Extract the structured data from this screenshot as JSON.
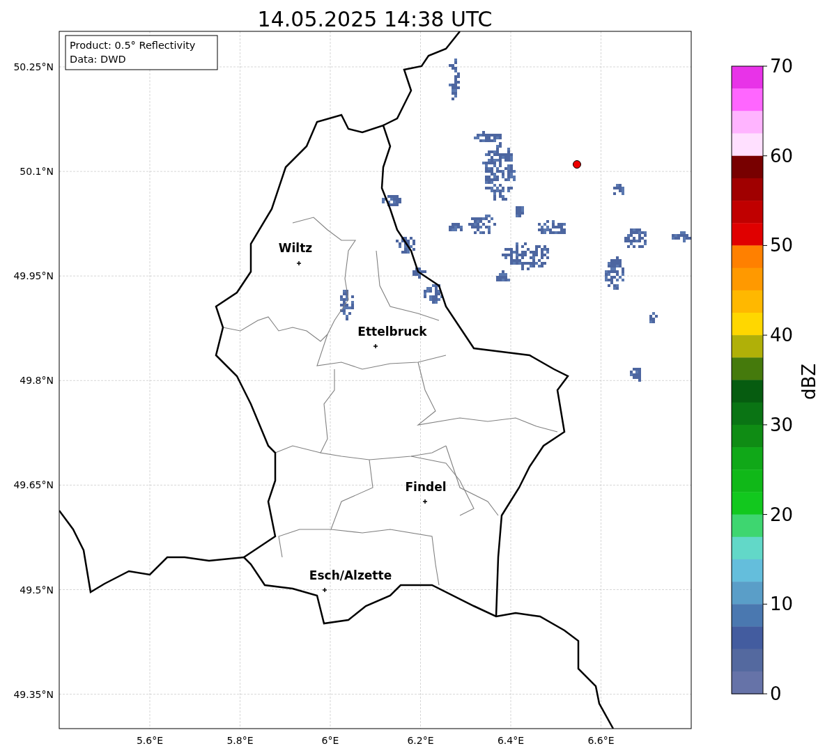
{
  "title": "14.05.2025 14:38 UTC",
  "info_box": [
    "Product: 0.5° Reflectivity",
    "Data: DWD"
  ],
  "lat_ticks": [
    "50.25°N",
    "50.1°N",
    "49.95°N",
    "49.8°N",
    "49.65°N",
    "49.5°N",
    "49.35°N"
  ],
  "lon_ticks": [
    "5.6°E",
    "5.8°E",
    "6°E",
    "6.2°E",
    "6.4°E",
    "6.6°E"
  ],
  "cities": [
    {
      "name": "Wiltz"
    },
    {
      "name": "Ettelbruck"
    },
    {
      "name": "Findel"
    },
    {
      "name": "Esch/Alzette"
    }
  ],
  "colorbar": {
    "label": "dBZ",
    "ticks": [
      "70",
      "60",
      "50",
      "40",
      "30",
      "20",
      "10",
      "0"
    ],
    "bins": [
      {
        "color": "#e833e8"
      },
      {
        "color": "#ff66ff"
      },
      {
        "color": "#ffb4ff"
      },
      {
        "color": "#ffe0ff"
      },
      {
        "color": "#780000"
      },
      {
        "color": "#a00000"
      },
      {
        "color": "#c00000"
      },
      {
        "color": "#e00000"
      },
      {
        "color": "#ff8000"
      },
      {
        "color": "#ff9900"
      },
      {
        "color": "#ffb800"
      },
      {
        "color": "#ffd700"
      },
      {
        "color": "#b0b008"
      },
      {
        "color": "#457a0c"
      },
      {
        "color": "#065c10"
      },
      {
        "color": "#0a7414"
      },
      {
        "color": "#0f8c14"
      },
      {
        "color": "#10a818"
      },
      {
        "color": "#10b818"
      },
      {
        "color": "#12c81e"
      },
      {
        "color": "#3ed670"
      },
      {
        "color": "#62d8c8"
      },
      {
        "color": "#64bedc"
      },
      {
        "color": "#5a9ec8"
      },
      {
        "color": "#4a78b0"
      },
      {
        "color": "#435c9f"
      },
      {
        "color": "#54699f"
      },
      {
        "color": "#6673a8"
      }
    ]
  }
}
